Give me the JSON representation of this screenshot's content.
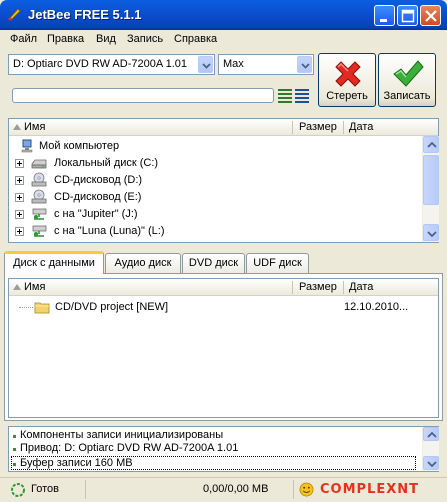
{
  "window": {
    "title": "JetBee FREE 5.1.1"
  },
  "menu": [
    "Файл",
    "Правка",
    "Вид",
    "Запись",
    "Справка"
  ],
  "toolbar": {
    "drive": "D: Optiarc DVD RW AD-7200A 1.01",
    "speed": "Max",
    "erase_label": "Стереть",
    "burn_label": "Записать"
  },
  "explorer": {
    "columns": [
      "Имя",
      "Размер",
      "Дата"
    ],
    "items": [
      {
        "label": "Мой компьютер",
        "icon": "computer-icon"
      },
      {
        "label": "Локальный диск (C:)",
        "icon": "hard-drive-icon"
      },
      {
        "label": "CD-дисковод (D:)",
        "icon": "cd-drive-icon"
      },
      {
        "label": "CD-дисковод (E:)",
        "icon": "cd-drive-icon"
      },
      {
        "label": "с на \"Jupiter\" (J:)",
        "icon": "network-drive-icon"
      },
      {
        "label": "с на \"Luna (Luna)\" (L:)",
        "icon": "network-drive-icon"
      }
    ]
  },
  "tabs": [
    "Диск с данными",
    "Аудио диск",
    "DVD диск",
    "UDF диск"
  ],
  "project": {
    "columns": [
      "Имя",
      "Размер",
      "Дата"
    ],
    "items": [
      {
        "label": "CD/DVD project [NEW]",
        "date": "12.10.2010..."
      }
    ]
  },
  "log": [
    "Компоненты записи инициализированы",
    "Привод: D: Optiarc DVD RW AD-7200A 1.01",
    "Буфер записи 160 MB"
  ],
  "status": {
    "state": "Готов",
    "size": "0,00/0,00 MB",
    "brand": "COMPLEXNT"
  },
  "colors": {
    "title_bar": "#0b4ed0",
    "accent_tab": "#ffc83c",
    "brand_red": "#e8301c"
  }
}
